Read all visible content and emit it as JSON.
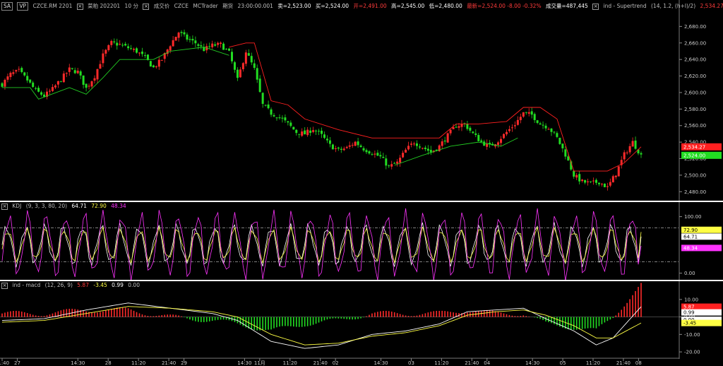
{
  "header": {
    "symbol_box": "SA",
    "vp_box": "VP",
    "instrument": "CZCE.RM 2201",
    "name_label": "菜粕 202201",
    "interval": "10 分",
    "price_type": "成交价",
    "exchange": "CZCE",
    "platform": "MCTrader",
    "period": "期货",
    "time": "23:00:00.001",
    "sell": "卖=2,523.00",
    "buy": "买=2,524.00",
    "open": "开=2,491.00",
    "high": "高=2,545.00",
    "low": "低=2,480.00",
    "close": "收=2,524.00",
    "change": "最新=2,524.00 -8.00 -0.32%",
    "volume": "成交量=487,445",
    "indicator_label": "ind - Supertrend",
    "indicator_params": "(14, 1.2, (h+l)/2)",
    "indicator_value": "2,534.27"
  },
  "kdj_header": {
    "label": "KDJ",
    "params": "(9, 3, 3, 80, 20)",
    "k": "64.71",
    "d": "72.90",
    "j": "48.34"
  },
  "macd_header": {
    "label": "ind - macd",
    "params": "(12, 26, 9)",
    "v1": "5.87",
    "v2": "-3.45",
    "v3": "0.99",
    "v4": "0.00"
  },
  "colors": {
    "up": "#ff2a2a",
    "down": "#22dd22",
    "supertrend_up": "#22cc22",
    "supertrend_down": "#ff2020",
    "k": "#ffffff",
    "d": "#ffff44",
    "j": "#ff33ff",
    "macd": "#ffffff",
    "signal": "#ffff44",
    "divider": "#ffffff",
    "grid": "#2a2a2a"
  },
  "chart_data": [
    {
      "type": "candlestick",
      "title": "CZCE.RM 2201",
      "ylim": [
        2470,
        2700
      ],
      "yticks": [
        "2,680.00",
        "2,660.00",
        "2,640.00",
        "2,620.00",
        "2,600.00",
        "2,580.00",
        "2,560.00",
        "2,540.00",
        "2,520.00",
        "2,500.00",
        "2,480.00"
      ],
      "ytick_values": [
        2680,
        2660,
        2640,
        2620,
        2600,
        2580,
        2560,
        2540,
        2520,
        2500,
        2480
      ],
      "price_labels": [
        {
          "value": 2534.27,
          "text": "2,534.27",
          "color": "#ff2020"
        },
        {
          "value": 2524,
          "text": "2,524.00",
          "color": "#22dd22"
        }
      ],
      "close_path": [
        [
          0,
          2610
        ],
        [
          3,
          2622
        ],
        [
          6,
          2626
        ],
        [
          9,
          2615
        ],
        [
          12,
          2602
        ],
        [
          15,
          2596
        ],
        [
          18,
          2604
        ],
        [
          21,
          2616
        ],
        [
          24,
          2628
        ],
        [
          27,
          2625
        ],
        [
          30,
          2605
        ],
        [
          33,
          2620
        ],
        [
          36,
          2645
        ],
        [
          39,
          2660
        ],
        [
          42,
          2658
        ],
        [
          45,
          2654
        ],
        [
          48,
          2650
        ],
        [
          51,
          2642
        ],
        [
          54,
          2630
        ],
        [
          57,
          2640
        ],
        [
          60,
          2658
        ],
        [
          63,
          2673
        ],
        [
          66,
          2665
        ],
        [
          69,
          2660
        ],
        [
          72,
          2652
        ],
        [
          75,
          2657
        ],
        [
          78,
          2658
        ],
        [
          81,
          2648
        ],
        [
          84,
          2615
        ],
        [
          87,
          2650
        ],
        [
          90,
          2628
        ],
        [
          93,
          2585
        ],
        [
          96,
          2575
        ],
        [
          99,
          2570
        ],
        [
          102,
          2562
        ],
        [
          105,
          2552
        ],
        [
          108,
          2550
        ],
        [
          111,
          2556
        ],
        [
          114,
          2548
        ],
        [
          117,
          2536
        ],
        [
          120,
          2530
        ],
        [
          123,
          2533
        ],
        [
          126,
          2540
        ],
        [
          129,
          2532
        ],
        [
          132,
          2527
        ],
        [
          135,
          2522
        ],
        [
          138,
          2510
        ],
        [
          141,
          2515
        ],
        [
          144,
          2530
        ],
        [
          147,
          2540
        ],
        [
          150,
          2534
        ],
        [
          153,
          2528
        ],
        [
          156,
          2535
        ],
        [
          159,
          2548
        ],
        [
          162,
          2560
        ],
        [
          165,
          2562
        ],
        [
          168,
          2550
        ],
        [
          171,
          2540
        ],
        [
          174,
          2535
        ],
        [
          177,
          2542
        ],
        [
          180,
          2552
        ],
        [
          183,
          2562
        ],
        [
          186,
          2575
        ],
        [
          189,
          2573
        ],
        [
          192,
          2562
        ],
        [
          195,
          2558
        ],
        [
          198,
          2545
        ],
        [
          201,
          2525
        ],
        [
          204,
          2500
        ],
        [
          207,
          2492
        ],
        [
          210,
          2490
        ],
        [
          213,
          2492
        ],
        [
          216,
          2485
        ],
        [
          219,
          2502
        ],
        [
          222,
          2525
        ],
        [
          225,
          2540
        ],
        [
          228,
          2524
        ]
      ],
      "supertrend": [
        {
          "dir": "up",
          "points": [
            [
              0,
              2606
            ],
            [
              10,
              2606
            ],
            [
              13,
              2592
            ],
            [
              24,
              2606
            ],
            [
              30,
              2598
            ],
            [
              36,
              2618
            ],
            [
              42,
              2640
            ],
            [
              54,
              2640
            ],
            [
              60,
              2650
            ],
            [
              72,
              2655
            ],
            [
              81,
              2645
            ]
          ]
        },
        {
          "dir": "down",
          "points": [
            [
              81,
              2655
            ],
            [
              87,
              2660
            ],
            [
              90,
              2660
            ],
            [
              96,
              2590
            ],
            [
              102,
              2585
            ],
            [
              108,
              2568
            ],
            [
              120,
              2555
            ],
            [
              132,
              2545
            ],
            [
              140,
              2545
            ],
            [
              150,
              2545
            ],
            [
              156,
              2545
            ],
            [
              162,
              2562
            ],
            [
              170,
              2562
            ],
            [
              180,
              2565
            ],
            [
              186,
              2582
            ],
            [
              192,
              2582
            ],
            [
              198,
              2568
            ],
            [
              204,
              2505
            ],
            [
              212,
              2505
            ],
            [
              216,
              2505
            ],
            [
              222,
              2515
            ],
            [
              228,
              2534.27
            ]
          ]
        },
        {
          "dir": "up",
          "points": [
            [
              140,
              2512
            ],
            [
              150,
              2524
            ],
            [
              160,
              2535
            ],
            [
              170,
              2540
            ],
            [
              178,
              2535
            ],
            [
              184,
              2545
            ]
          ]
        }
      ]
    },
    {
      "type": "line",
      "title": "KDJ",
      "ylim": [
        -8,
        112
      ],
      "yticks": [
        "100.00",
        "0.00"
      ],
      "ytick_values": [
        100,
        0
      ],
      "reference_lines": [
        80,
        20
      ],
      "series": [
        {
          "name": "K",
          "color": "#ffffff",
          "cycles": 34,
          "amp": 32,
          "base": 50,
          "last": 64.71
        },
        {
          "name": "D",
          "color": "#ffff44",
          "cycles": 34,
          "amp": 26,
          "base": 50,
          "last": 72.9
        },
        {
          "name": "J",
          "color": "#ff33ff",
          "cycles": 34,
          "amp": 52,
          "base": 50,
          "last": 48.34
        }
      ],
      "value_labels": [
        {
          "value": 72.9,
          "text": "72.90",
          "color": "#ffff44"
        },
        {
          "value": 64.71,
          "text": "64.71",
          "color": "#ffffff"
        },
        {
          "value": 48.34,
          "text": "48.34",
          "color": "#ff33ff"
        }
      ]
    },
    {
      "type": "bar",
      "title": "ind - macd",
      "ylim": [
        -22,
        16
      ],
      "yticks": [
        "10.00",
        "0.00",
        "-10.00",
        "-20.00"
      ],
      "ytick_values": [
        10,
        0,
        -10,
        -20
      ],
      "macd_path": [
        [
          0,
          -2
        ],
        [
          15,
          -1
        ],
        [
          30,
          4
        ],
        [
          45,
          8
        ],
        [
          60,
          5
        ],
        [
          75,
          2
        ],
        [
          84,
          -2
        ],
        [
          96,
          -14
        ],
        [
          108,
          -18
        ],
        [
          120,
          -16
        ],
        [
          132,
          -10
        ],
        [
          144,
          -8
        ],
        [
          156,
          -4
        ],
        [
          166,
          3
        ],
        [
          176,
          4
        ],
        [
          186,
          5
        ],
        [
          194,
          -1
        ],
        [
          204,
          -8
        ],
        [
          212,
          -16
        ],
        [
          218,
          -12
        ],
        [
          228,
          5.87
        ]
      ],
      "signal_path": [
        [
          0,
          -3
        ],
        [
          15,
          -2
        ],
        [
          30,
          2
        ],
        [
          45,
          6
        ],
        [
          60,
          5
        ],
        [
          75,
          3
        ],
        [
          84,
          0
        ],
        [
          96,
          -10
        ],
        [
          108,
          -16
        ],
        [
          120,
          -15
        ],
        [
          132,
          -11
        ],
        [
          144,
          -9
        ],
        [
          156,
          -5
        ],
        [
          166,
          1
        ],
        [
          176,
          3
        ],
        [
          186,
          4
        ],
        [
          194,
          1
        ],
        [
          204,
          -5
        ],
        [
          212,
          -12
        ],
        [
          218,
          -12
        ],
        [
          228,
          -3.45
        ]
      ],
      "value_labels": [
        {
          "value": 5.87,
          "text": "5.87",
          "color": "#ff2020"
        },
        {
          "value": 0.99,
          "text": "0.99",
          "color": "#ffffff"
        },
        {
          "value": 0,
          "text": "0.00",
          "color": "#ffffff"
        },
        {
          "value": -3.45,
          "text": "-3.45",
          "color": "#ffff44"
        }
      ]
    }
  ],
  "x_axis": {
    "labels": [
      "21:40",
      "27",
      "14:30",
      "28",
      "11:20",
      "21:40",
      "29",
      "14:30",
      "11月",
      "11:20",
      "21:40",
      "02",
      "14:30",
      "03",
      "11:20",
      "21:40",
      "04",
      "14:30",
      "05",
      "11:20",
      "21:40",
      "08"
    ],
    "positions": [
      0,
      6,
      30,
      42,
      54,
      66,
      72,
      96,
      102,
      114,
      126,
      132,
      150,
      162,
      174,
      186,
      192,
      210,
      222,
      234,
      246,
      252
    ],
    "total": 260
  }
}
